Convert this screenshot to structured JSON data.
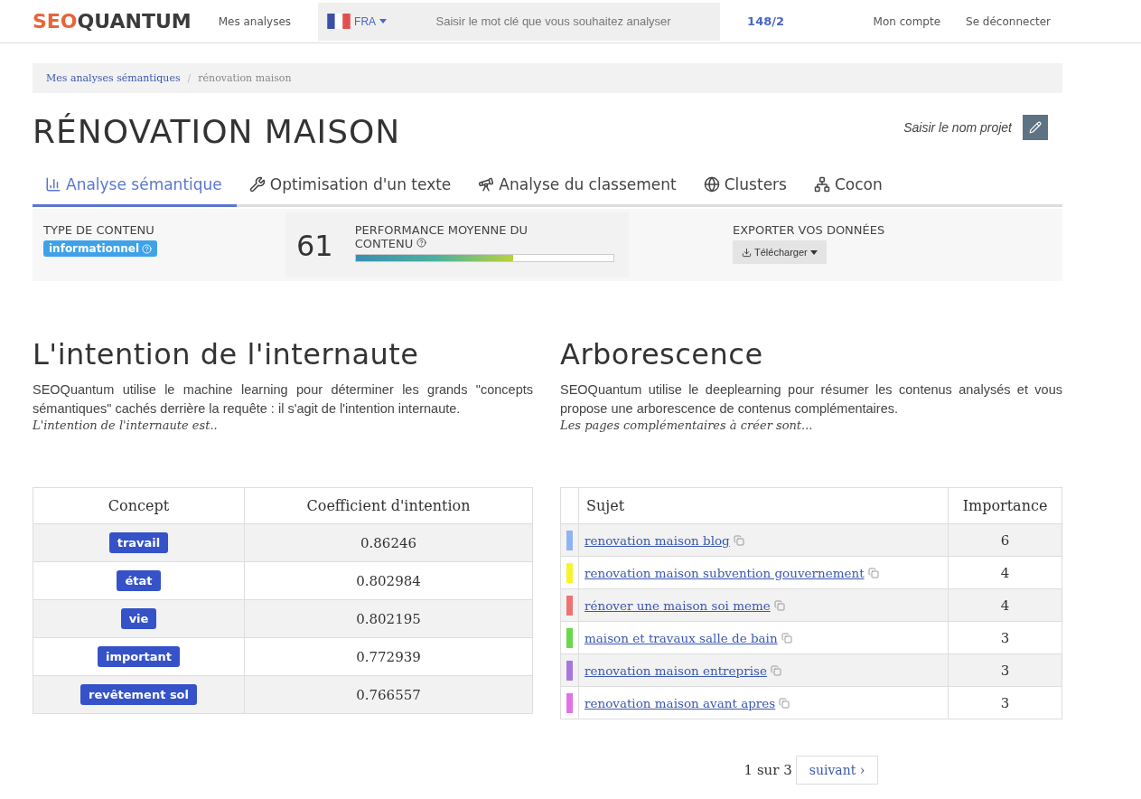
{
  "header": {
    "logo": {
      "accent": "SEO",
      "rest": "QUANTUM"
    },
    "nav_link": "Mes analyses",
    "language": "FRA",
    "search": {
      "placeholder": "Saisir le mot clé que vous souhaitez analyser"
    },
    "credits": "148/2",
    "account_link": "Mon compte",
    "logout_link": "Se déconnecter"
  },
  "breadcrumb": [
    {
      "label": "Mes analyses sémantiques",
      "kind": "link"
    },
    {
      "label": "/",
      "kind": "separator"
    },
    {
      "label": "rénovation maison",
      "kind": "current"
    }
  ],
  "page_title": "RÉNOVATION MAISON",
  "project_name": {
    "placeholder": "Saisir le nom projet"
  },
  "tabs": [
    {
      "label": "Analyse sémantique",
      "selected": true
    },
    {
      "label": "Optimisation d'un texte",
      "selected": false
    },
    {
      "label": "Analyse du classement",
      "selected": false
    },
    {
      "label": "Clusters",
      "selected": false
    },
    {
      "label": "Cocon",
      "selected": false
    }
  ],
  "summary": {
    "content_type": {
      "label": "TYPE DE CONTENU",
      "value": "informationnel"
    },
    "performance": {
      "score": "61",
      "label": "PERFORMANCE MOYENNE DU CONTENU",
      "level": 0.61
    },
    "export": {
      "label": "EXPORTER VOS DONNÉES",
      "button": "Télécharger"
    }
  },
  "intent": {
    "title": "L'intention de l'internaute",
    "text": "SEOQuantum utilise le machine learning pour déterminer les grands \"concepts sémantiques\" cachés derrière la requête : il s'agit de l'intention internaute.",
    "lead": "L'intention de l'internaute est..",
    "columns": [
      "Concept",
      "Coefficient d'intention"
    ],
    "rows": [
      {
        "concept": "travail",
        "coefficient": "0.86246"
      },
      {
        "concept": "état",
        "coefficient": "0.802984"
      },
      {
        "concept": "vie",
        "coefficient": "0.802195"
      },
      {
        "concept": "important",
        "coefficient": "0.772939"
      },
      {
        "concept": "revêtement sol",
        "coefficient": "0.766557"
      }
    ]
  },
  "tree": {
    "title": "Arborescence",
    "text": "SEOQuantum utilise le deeplearning pour résumer les contenus analysés et vous propose une arborescence de contenus complémentaires.",
    "lead": "Les pages complémentaires à créer sont...",
    "columns": [
      "Sujet",
      "Importance"
    ],
    "rows": [
      {
        "subject": "renovation maison blog",
        "importance": "6",
        "color": "#8fb4f0"
      },
      {
        "subject": "renovation maison subvention gouvernement",
        "importance": "4",
        "color": "#f5f52a"
      },
      {
        "subject": "rénover une maison soi meme",
        "importance": "4",
        "color": "#ee7272"
      },
      {
        "subject": "maison et travaux salle de bain",
        "importance": "3",
        "color": "#6ad84c"
      },
      {
        "subject": "renovation maison entreprise",
        "importance": "3",
        "color": "#a678dc"
      },
      {
        "subject": "renovation maison avant apres",
        "importance": "3",
        "color": "#e272e8"
      }
    ],
    "pagination": {
      "status": "1 sur 3",
      "next": "suivant ›"
    }
  }
}
